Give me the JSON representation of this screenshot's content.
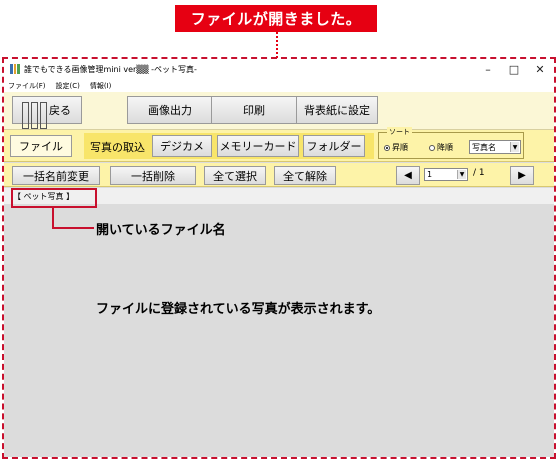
{
  "callout": {
    "title": "ファイルが開きました。",
    "tab_annotation": "開いているファイル名",
    "content_annotation": "ファイルに登録されている写真が表示されます。"
  },
  "window": {
    "title": "誰でもできる画像管理mini ver▒▒ -ペット写真-",
    "controls": {
      "minimize": "–",
      "maximize": "□",
      "close": "✕"
    },
    "menu": [
      "ファイル(F)",
      "設定(C)",
      "情報(I)"
    ]
  },
  "toolbar1": {
    "back_label": "戻る",
    "image_output_label": "画像出力",
    "print_label": "印刷",
    "set_wallpaper_label": "背表紙に設定"
  },
  "toolbar2": {
    "file_label": "ファイル",
    "import_label": "写真の取込",
    "camera_label": "デジカメ",
    "memory_card_label": "メモリーカード",
    "folder_label": "フォルダー",
    "sort": {
      "legend": "ソート",
      "ascending_label": "昇順",
      "descending_label": "降順",
      "selected_order": "ascending",
      "key_value": "写真名"
    }
  },
  "toolbar3": {
    "rename_all_label": "一括名前変更",
    "delete_all_label": "一括削除",
    "select_all_label": "全て選択",
    "deselect_all_label": "全て解除",
    "prev_icon": "◀",
    "next_icon": "▶",
    "page_current": "1",
    "page_total": "/ 1"
  },
  "tabs": [
    {
      "label": "【 ペット写真 】"
    }
  ],
  "colors": {
    "accent_red": "#e60012",
    "toolbar_bg": "#fdf3a8",
    "content_bg": "#dcdcdc"
  },
  "icons": [
    "app-icon",
    "back-icon",
    "prev-page-icon",
    "next-page-icon",
    "dropdown-arrow-icon"
  ]
}
